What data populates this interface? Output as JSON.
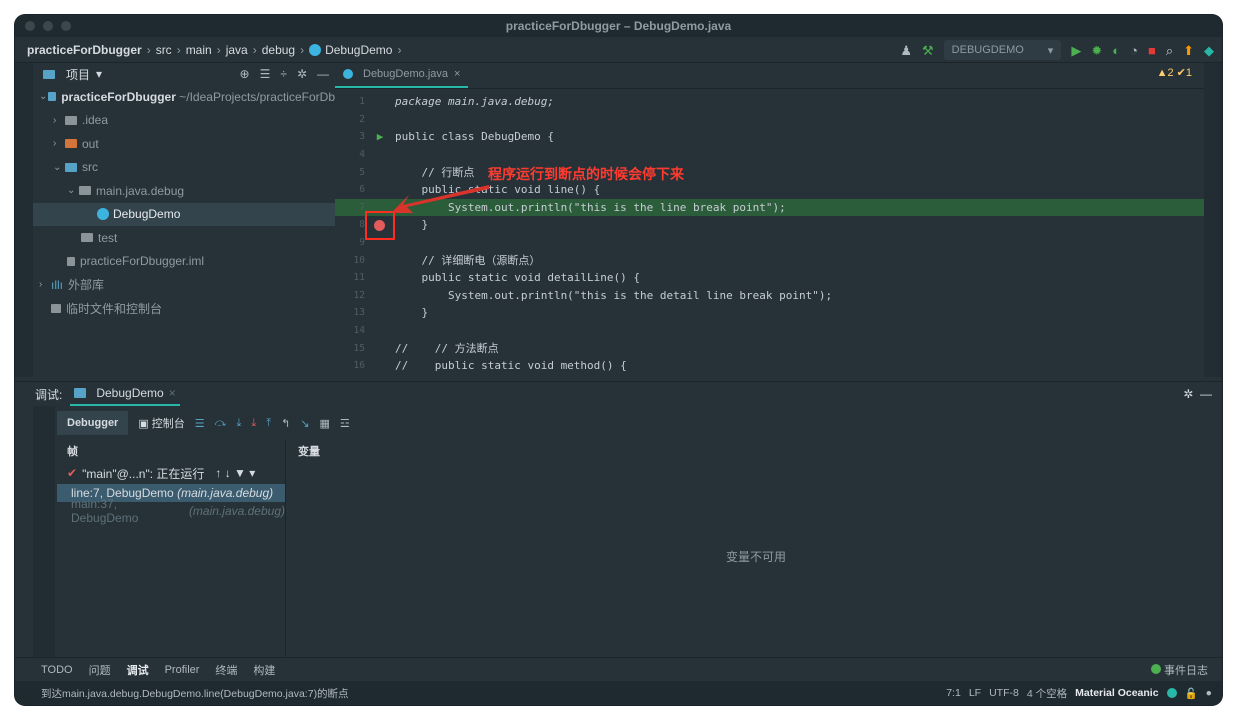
{
  "window": {
    "title": "practiceForDbugger – DebugDemo.java"
  },
  "breadcrumb": [
    "practiceForDbugger",
    "src",
    "main",
    "java",
    "debug",
    "DebugDemo"
  ],
  "toolbar": {
    "run_config": "DEBUGDEMO"
  },
  "project_panel": {
    "title": "项目",
    "tree": [
      {
        "label": "practiceForDbugger",
        "suffix": "~/IdeaProjects/practiceForDb"
      },
      {
        "label": ".idea"
      },
      {
        "label": "out"
      },
      {
        "label": "src"
      },
      {
        "label": "main.java.debug"
      },
      {
        "label": "DebugDemo"
      },
      {
        "label": "test"
      },
      {
        "label": "practiceForDbugger.iml"
      },
      {
        "label": "外部库"
      },
      {
        "label": "临时文件和控制台"
      }
    ]
  },
  "editor": {
    "tab": "DebugDemo.java",
    "inspection": "▲2 ✔1",
    "annotation": "程序运行到断点的时候会停下来",
    "lines": [
      {
        "n": "1",
        "code": "package main.java.debug;"
      },
      {
        "n": "2",
        "code": ""
      },
      {
        "n": "3",
        "code": "public class DebugDemo {"
      },
      {
        "n": "4",
        "code": ""
      },
      {
        "n": "5",
        "code": "    // 行断点"
      },
      {
        "n": "6",
        "code": "    public static void line() {"
      },
      {
        "n": "7",
        "code": "        System.out.println(\"this is the line break point\");"
      },
      {
        "n": "8",
        "code": "    }"
      },
      {
        "n": "9",
        "code": ""
      },
      {
        "n": "10",
        "code": "    // 详细断电（源断点）"
      },
      {
        "n": "11",
        "code": "    public static void detailLine() {"
      },
      {
        "n": "12",
        "code": "        System.out.println(\"this is the detail line break point\");"
      },
      {
        "n": "13",
        "code": "    }"
      },
      {
        "n": "14",
        "code": ""
      },
      {
        "n": "15",
        "code": "//    // 方法断点"
      },
      {
        "n": "16",
        "code": "//    public static void method() {"
      }
    ]
  },
  "debug": {
    "label": "调试:",
    "tab": "DebugDemo",
    "tools": {
      "debugger": "Debugger",
      "console": "控制台"
    },
    "frames_header": "帧",
    "thread": "\"main\"@...n\": 正在运行",
    "frames": [
      {
        "text": "line:7, DebugDemo",
        "pkg": "(main.java.debug)"
      },
      {
        "text": "main:37, DebugDemo",
        "pkg": "(main.java.debug)"
      }
    ],
    "vars_header": "变量",
    "vars_empty": "变量不可用"
  },
  "bottom_tabs": [
    "TODO",
    "问题",
    "调试",
    "Profiler",
    "终端",
    "构建"
  ],
  "event_log": "事件日志",
  "status": {
    "message": "到达main.java.debug.DebugDemo.line(DebugDemo.java:7)的断点",
    "position": "7:1",
    "line_sep": "LF",
    "encoding": "UTF-8",
    "indent": "4 个空格",
    "theme": "Material Oceanic"
  }
}
